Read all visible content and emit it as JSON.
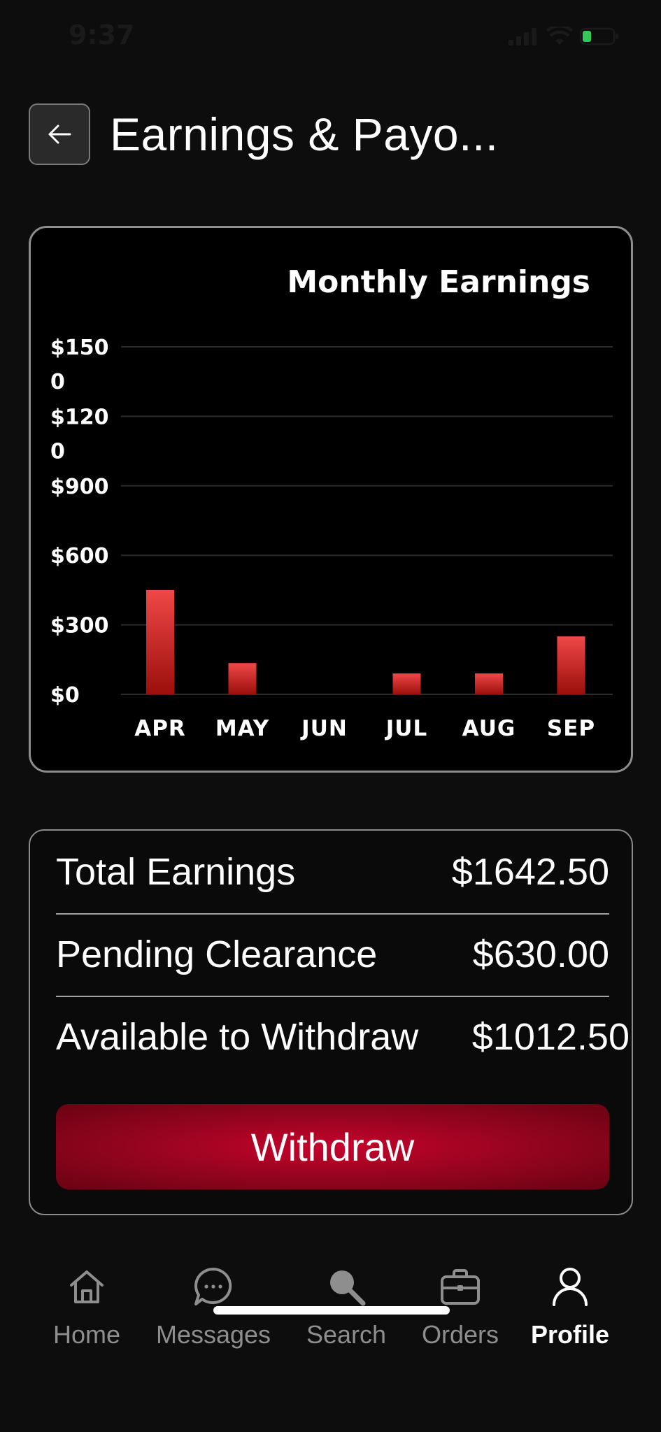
{
  "status_bar": {
    "time": "9:37"
  },
  "header": {
    "title": "Earnings & Payo..."
  },
  "chart_data": {
    "type": "bar",
    "title": "Monthly Earnings",
    "categories": [
      "APR",
      "MAY",
      "JUN",
      "JUL",
      "AUG",
      "SEP"
    ],
    "values": [
      450,
      135,
      0,
      90,
      90,
      250
    ],
    "y_ticks": [
      "$1500",
      "$1200",
      "$900",
      "$600",
      "$300",
      "$0"
    ],
    "y_tick_values": [
      1500,
      1200,
      900,
      600,
      300,
      0
    ],
    "ylim": [
      0,
      1500
    ],
    "grid": true,
    "legend": "none",
    "bar_colors": [
      "#f04848",
      "#9b0f0b"
    ]
  },
  "summary": {
    "rows": [
      {
        "label": "Total Earnings",
        "value": "$1642.50"
      },
      {
        "label": "Pending Clearance",
        "value": "$630.00"
      },
      {
        "label": "Available to Withdraw",
        "value": "$1012.50"
      }
    ],
    "withdraw_label": "Withdraw"
  },
  "nav": {
    "items": [
      {
        "label": "Home",
        "icon": "home-icon"
      },
      {
        "label": "Messages",
        "icon": "chat-bubble-icon"
      },
      {
        "label": "Search",
        "icon": "search-icon"
      },
      {
        "label": "Orders",
        "icon": "briefcase-icon"
      },
      {
        "label": "Profile",
        "icon": "user-icon",
        "active": true
      }
    ]
  },
  "colors": {
    "background": "#0e0d0e",
    "accent": "#c8022c",
    "card_border": "#8c8c8c"
  }
}
